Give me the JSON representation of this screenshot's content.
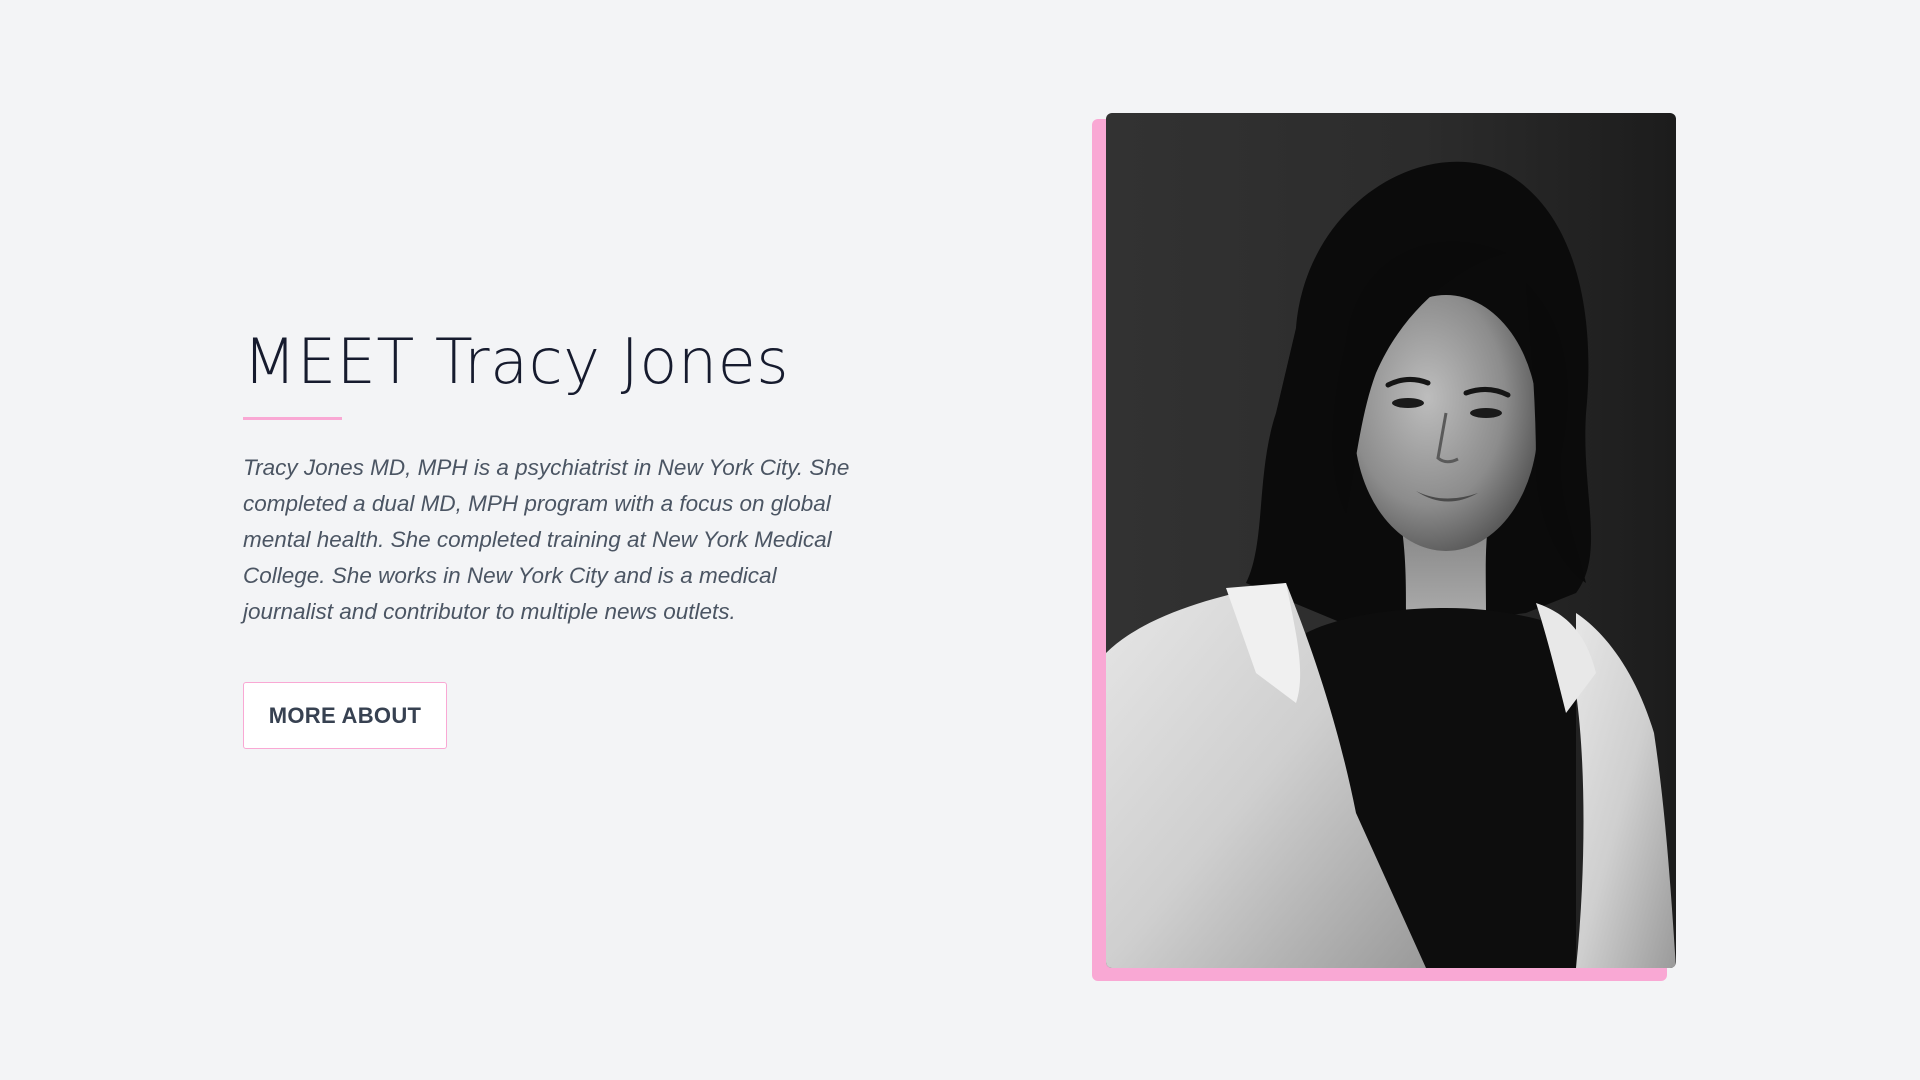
{
  "about": {
    "title": "MEET Tracy Jones",
    "bio": "Tracy Jones MD, MPH is a psychiatrist in New York City. She completed a dual MD, MPH program with a focus on global mental health. She completed training at New York Medical College. She works in New York City and is a medical journalist and contributor to multiple news outlets.",
    "more_button_label": "MORE ABOUT"
  },
  "theme": {
    "accent": "#f9a8d4",
    "background": "#f3f4f6",
    "heading_color": "#161b2e",
    "body_text_color": "#4b5563"
  },
  "portrait": {
    "style": "black-and-white photograph",
    "icon": "portrait-photo"
  }
}
